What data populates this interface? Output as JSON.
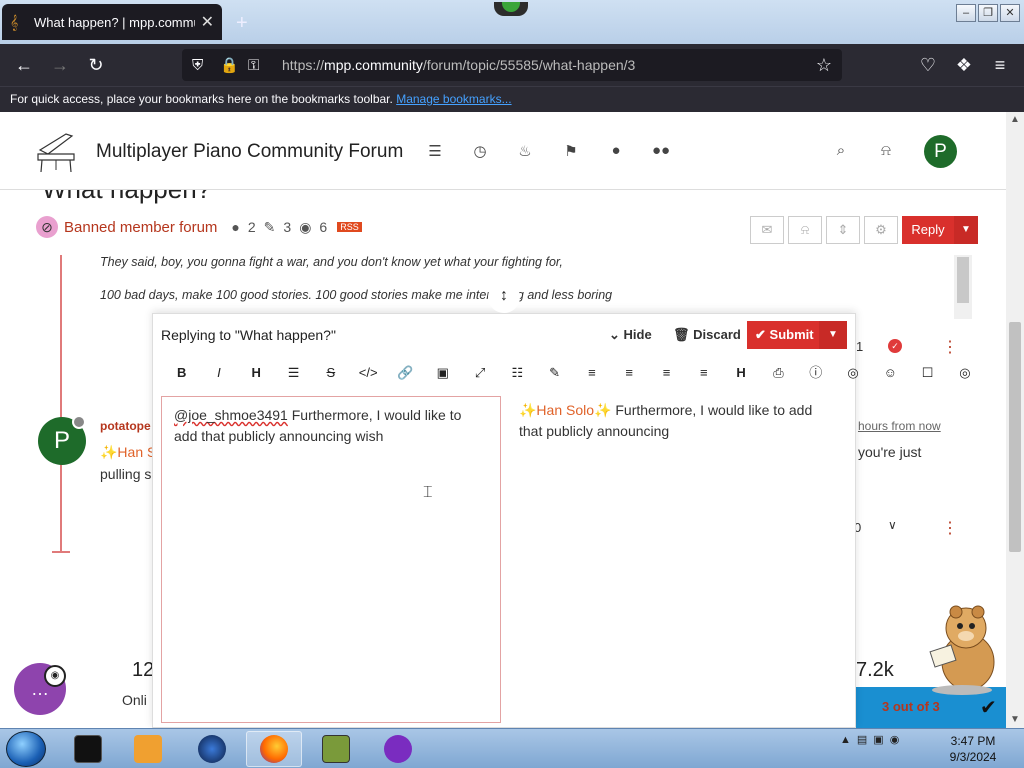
{
  "browser": {
    "tab_title": "What happen? | mpp.communi",
    "new_tab": "+",
    "url_domain": "mpp.community",
    "url_prefix": "https://",
    "url_path": "/forum/topic/55585/what-happen/3",
    "bookmarks_message": "For quick access, place your bookmarks here on the bookmarks toolbar.",
    "bookmarks_link": "Manage bookmarks..."
  },
  "site": {
    "title": "Multiplayer Piano Community Forum",
    "nav_icons": [
      "categories-icon",
      "recent-icon",
      "popular-icon",
      "tags-icon",
      "users-icon",
      "groups-icon"
    ],
    "avatar_letter": "P"
  },
  "topic": {
    "title": "What happen?",
    "category": "Banned member forum",
    "posters": "2",
    "posts": "3",
    "views": "6",
    "reply_label": "Reply"
  },
  "posts": {
    "quote1": "They said, boy, you gonna fight a war, and you don't know yet what your fighting for,",
    "quote2": "100 bad days, make 100 good stories. 100 good stories make me interesting and less boring",
    "p1_votes": "1",
    "p2_user": "potatope",
    "p2_line1": "✨Han S",
    "p2_line2": "pulling s",
    "p2_time": "hours from now",
    "p2_text": "you're just",
    "p2_votes": "0",
    "avatar_letter": "P"
  },
  "composer": {
    "title": "Replying to \"What happen?\"",
    "hide": "Hide",
    "discard": "Discard",
    "submit": "Submit",
    "editor_mention": "@joe_shmoe3491",
    "editor_text": " Furthermore, I would like to add that publicly announcing wish",
    "preview_mention": "✨Han Solo✨",
    "preview_text": " Furthermore, I would like to add that publicly announcing",
    "toolbar": [
      "B",
      "I",
      "H",
      "☰",
      "S",
      "</>",
      "🔗",
      "▣",
      "⤢",
      "☷",
      "✎",
      "≡",
      "≡",
      "≡",
      "≡",
      "H",
      "⎙",
      "ⓘ",
      "◎",
      "☺",
      "☐",
      "◎"
    ]
  },
  "footer_stats": {
    "left_value": "12",
    "left_label": "Onli",
    "right_value": "7.2k",
    "unread": "3 out of 3"
  },
  "taskbar": {
    "time": "3:47 PM",
    "date": "9/3/2024",
    "apps": [
      "terminal",
      "media-player",
      "browser-globe",
      "firefox",
      "game-box",
      "app-purple"
    ]
  },
  "colors": {
    "accent": "#d9302c",
    "link": "#b5361d",
    "avatar": "#1e6b2a",
    "chat": "#8e44ad",
    "unread": "#1a8fd1"
  }
}
